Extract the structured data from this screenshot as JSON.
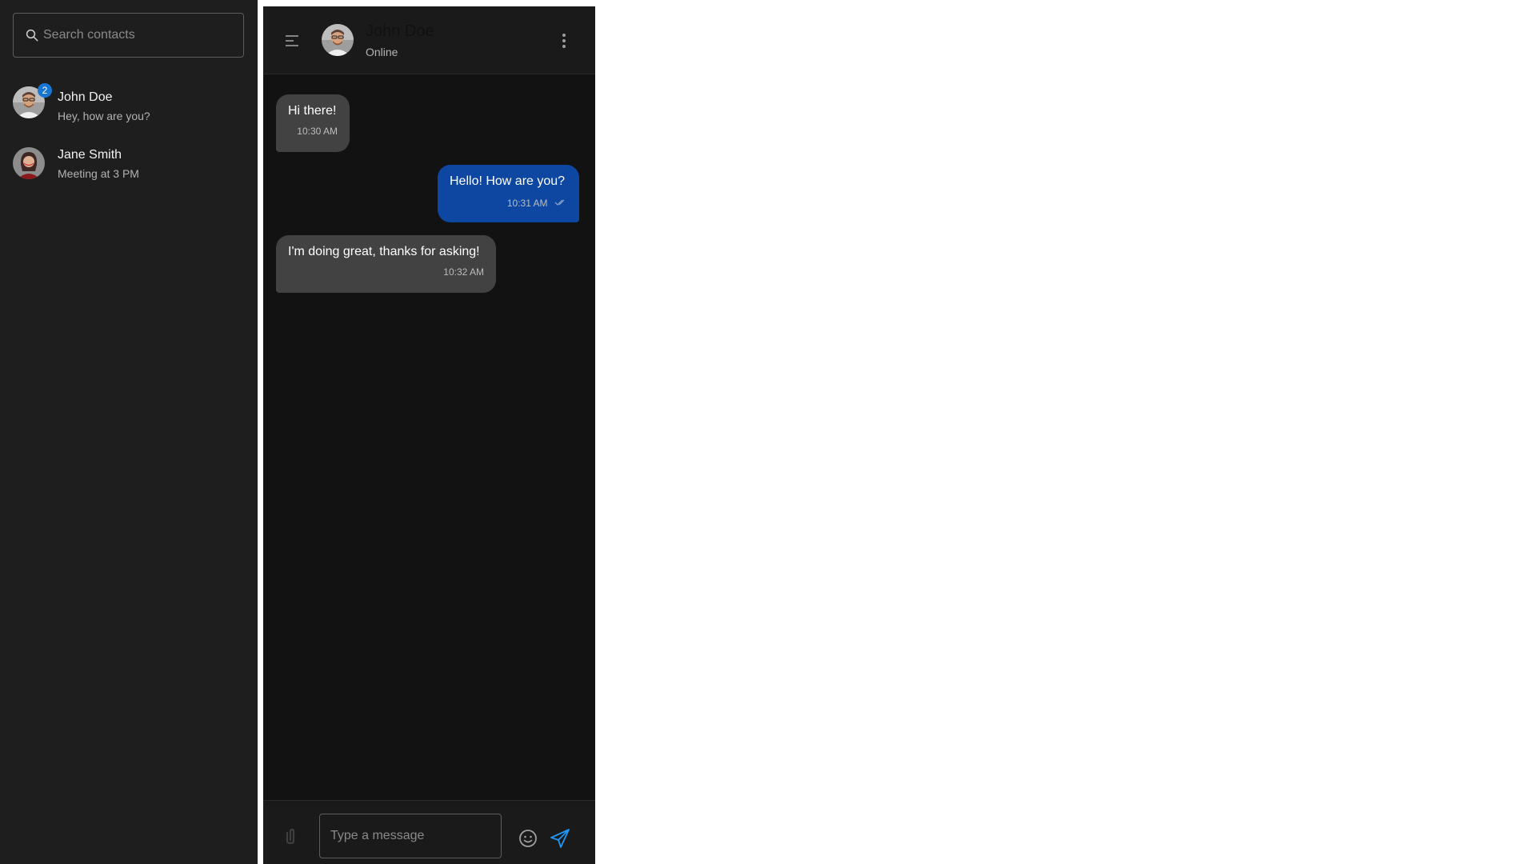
{
  "sidebar": {
    "search": {
      "placeholder": "Search contacts",
      "value": ""
    },
    "contacts": [
      {
        "name": "John Doe",
        "preview": "Hey, how are you?",
        "unread": "2",
        "avatar_icon": "man-avatar"
      },
      {
        "name": "Jane Smith",
        "preview": "Meeting at 3 PM",
        "avatar_icon": "woman-avatar"
      }
    ]
  },
  "chat": {
    "header": {
      "name": "John Doe",
      "status": "Online"
    },
    "messages": [
      {
        "direction": "incoming",
        "text": "Hi there!",
        "time": "10:30 AM"
      },
      {
        "direction": "outgoing",
        "text": "Hello! How are you?",
        "time": "10:31 AM",
        "status_icon": "double-check"
      },
      {
        "direction": "incoming",
        "text": "I'm doing great, thanks for asking!",
        "time": "10:32 AM"
      }
    ],
    "composer": {
      "placeholder": "Type a message",
      "value": ""
    }
  },
  "colors": {
    "sidebar_bg": "#1e1e1e",
    "chat_bg": "#121212",
    "incoming_bubble": "#424242",
    "outgoing_bubble": "#0d47a1",
    "accent": "#1976d2",
    "send": "#2196f3"
  }
}
